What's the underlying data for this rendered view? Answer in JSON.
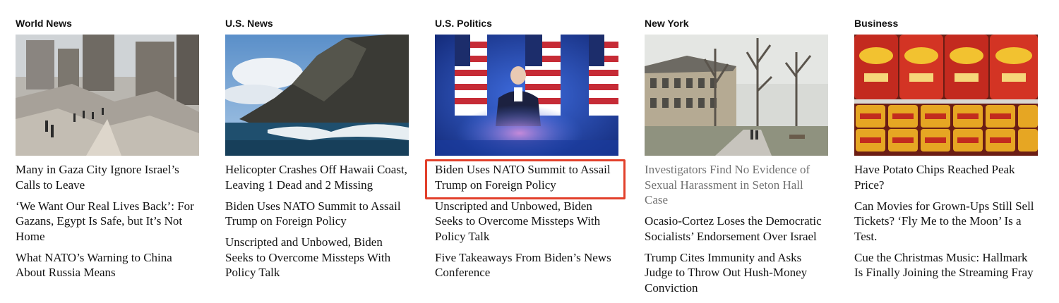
{
  "sections": [
    {
      "label": "World News",
      "image_alt": "Destroyed buildings in Gaza City with people walking on rubble",
      "stories": [
        "Many in Gaza City Ignore Israel’s Calls to Leave",
        "‘We Want Our Real Lives Back’: For Gazans, Egypt Is Safe, but It’s Not Home",
        "What NATO’s Warning to China About Russia Means"
      ]
    },
    {
      "label": "U.S. News",
      "image_alt": "Rocky cliff over ocean waves",
      "stories": [
        "Helicopter Crashes Off Hawaii Coast, Leaving 1 Dead and 2 Missing",
        "Biden Uses NATO Summit to Assail Trump on Foreign Policy",
        "Unscripted and Unbowed, Biden Seeks to Overcome Missteps With Policy Talk"
      ]
    },
    {
      "label": "U.S. Politics",
      "image_alt": "Biden speaking at a podium in front of American flags",
      "stories": [
        "Biden Uses NATO Summit to Assail Trump on Foreign Policy",
        "Unscripted and Unbowed, Biden Seeks to Overcome Missteps With Policy Talk",
        "Five Takeaways From Biden’s News Conference"
      ]
    },
    {
      "label": "New York",
      "image_alt": "Brick university building with bare trees",
      "stories": [
        "Investigators Find No Evidence of Sexual Harassment in Seton Hall Case",
        "Ocasio-Cortez Loses the Democratic Socialists’ Endorsement Over Israel",
        "Trump Cites Immunity and Asks Judge to Throw Out Hush-Money Conviction"
      ]
    },
    {
      "label": "Business",
      "image_alt": "Bags of Fritos and cans of chili cheese on a store shelf",
      "stories": [
        "Have Potato Chips Reached Peak Price?",
        "Can Movies for Grown-Ups Still Sell Tickets? ‘Fly Me to the Moon’ Is a Test.",
        "Cue the Christmas Music: Hallmark Is Finally Joining the Streaming Fray"
      ]
    }
  ],
  "colors": {
    "text": "#121212",
    "visited_text": "#727272",
    "highlight": "#e2402b"
  }
}
